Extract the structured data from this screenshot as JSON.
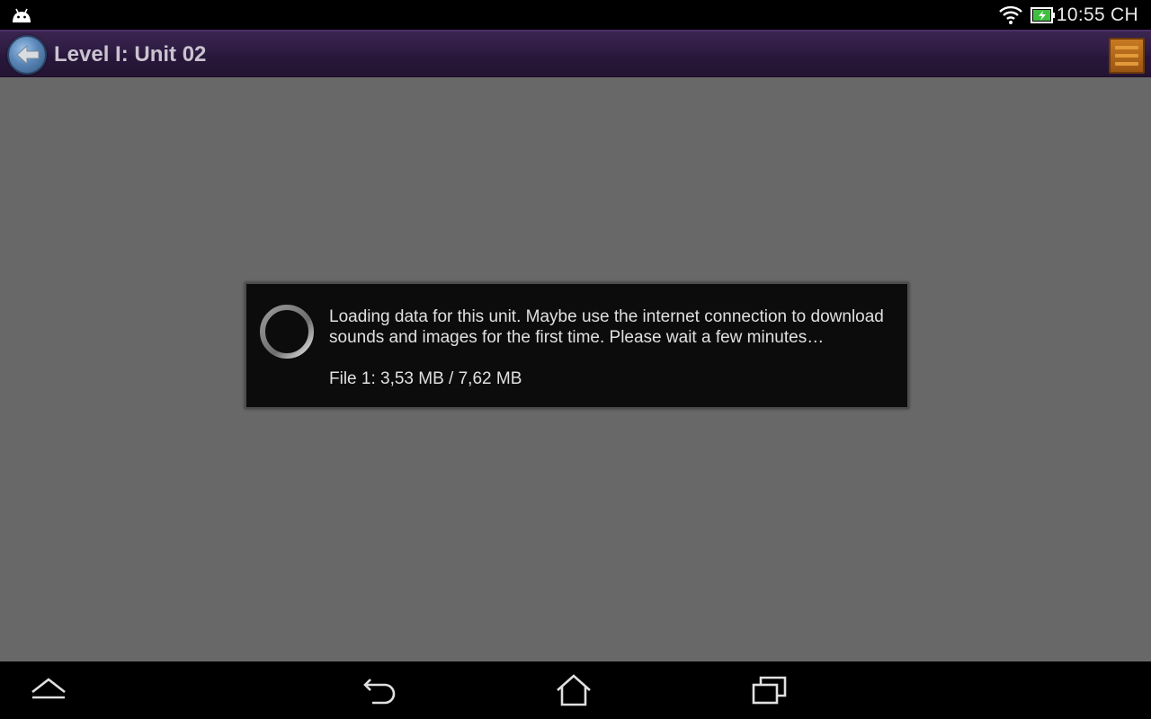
{
  "status_bar": {
    "time": "10:55 CH",
    "icons": [
      "android-notification-icon",
      "wifi-icon",
      "battery-charging-icon"
    ]
  },
  "action_bar": {
    "title": "Level I: Unit 02",
    "back_icon": "back-arrow-icon",
    "menu_icon": "menu-icon"
  },
  "dialog": {
    "message": "Loading data for this unit. Maybe use the internet connection to download sounds and images for the first time. Please wait a few minutes…",
    "progress_text": "File 1: 3,53 MB / 7,62 MB",
    "spinner_icon": "loading-spinner-icon"
  },
  "nav_bar": {
    "buttons": [
      "hide-keyboard-icon",
      "back-icon",
      "home-icon",
      "recent-apps-icon"
    ]
  },
  "colors": {
    "action_bar": "#2e1b42",
    "main_background": "#686868",
    "dialog_background": "#0c0c0c",
    "back_button": "#5a86b8",
    "menu_button": "#b56a1a"
  }
}
